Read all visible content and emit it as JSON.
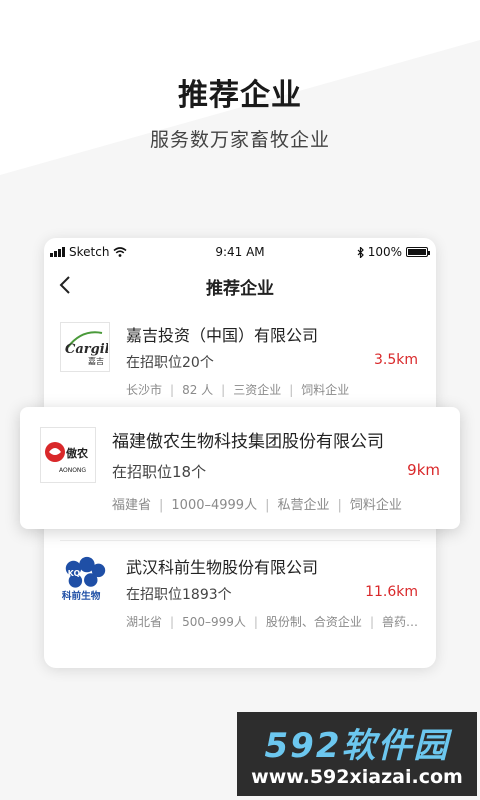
{
  "hero": {
    "title": "推荐企业",
    "subtitle": "服务数万家畜牧企业"
  },
  "status_bar": {
    "carrier": "Sketch",
    "time": "9:41 AM",
    "battery": "100%"
  },
  "navbar": {
    "title": "推荐企业"
  },
  "companies": [
    {
      "name": "嘉吉投资（中国）有限公司",
      "jobs": "在招职位20个",
      "distance": "3.5km",
      "logo_text": "Cargill",
      "logo_sub": "嘉吉",
      "tags": [
        "长沙市",
        "82 人",
        "三资企业",
        "饲料企业"
      ]
    },
    {
      "name": "福建傲农生物科技集团股份有限公司",
      "jobs": "在招职位18个",
      "distance": "9km",
      "logo_text": "傲农",
      "logo_sub": "AONONG",
      "tags": [
        "福建省",
        "1000–4999人",
        "私营企业",
        "饲料企业"
      ]
    },
    {
      "name": "武汉科前生物股份有限公司",
      "jobs": "在招职位1893个",
      "distance": "11.6km",
      "logo_text": "科前生物",
      "logo_sub": "KQ",
      "tags": [
        "湖北省",
        "500–999人",
        "股份制、合资企业",
        "兽药…"
      ]
    }
  ],
  "watermark": {
    "brand": "592软件园",
    "url": "www.592xiazai.com"
  },
  "colors": {
    "distance": "#d9282a",
    "watermark_brand": "#6cc7ef"
  }
}
